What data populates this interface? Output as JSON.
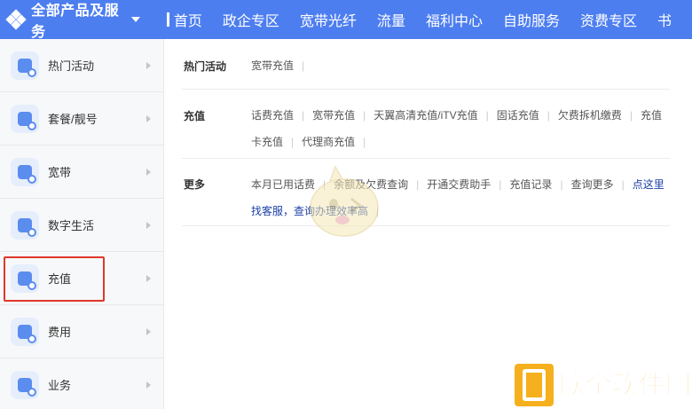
{
  "topbar": {
    "all_products": "全部产品及服务",
    "nav": [
      "首页",
      "政企专区",
      "宽带光纤",
      "流量",
      "福利中心",
      "自助服务",
      "资费专区",
      "书"
    ]
  },
  "sidebar": {
    "items": [
      {
        "label": "热门活动",
        "icon": "phone-activity-icon"
      },
      {
        "label": "套餐/靓号",
        "icon": "package-icon"
      },
      {
        "label": "宽带",
        "icon": "broadband-icon"
      },
      {
        "label": "数字生活",
        "icon": "digital-life-icon"
      },
      {
        "label": "充值",
        "icon": "recharge-icon"
      },
      {
        "label": "费用",
        "icon": "bill-icon"
      },
      {
        "label": "业务",
        "icon": "business-icon"
      }
    ],
    "selected": "充值"
  },
  "sections": {
    "hot": {
      "title": "热门活动",
      "links": [
        "宽带充值"
      ]
    },
    "recharge": {
      "title": "充值",
      "links": [
        "话费充值",
        "宽带充值",
        "天翼高清充值/iTV充值",
        "固话充值",
        "欠费拆机缴费",
        "充值卡充值",
        "代理商充值"
      ]
    },
    "more": {
      "title": "更多",
      "links": [
        "本月已用话费",
        "余额及欠费查询",
        "开通交费助手",
        "充值记录",
        "查询更多"
      ],
      "highlight_link": "点这里找客服，查询办理效率高"
    }
  },
  "colors": {
    "topbar": "#4d7ef0",
    "highlight_border": "#e0362c",
    "link_blue": "#1a3fa6"
  },
  "brand": {
    "text": "欧全软件园"
  }
}
